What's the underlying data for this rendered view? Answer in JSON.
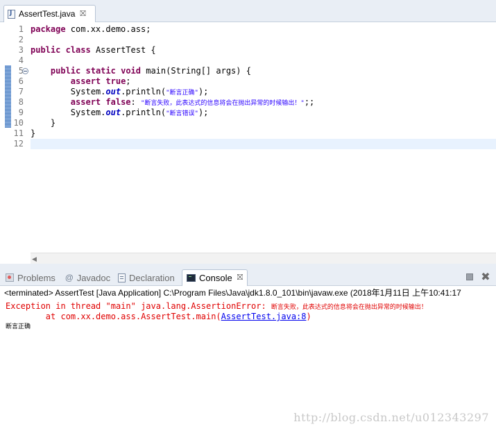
{
  "editor": {
    "tab": {
      "title": "AssertTest.java",
      "close": "⛝"
    },
    "line_numbers": [
      "1",
      "2",
      "3",
      "4",
      "5",
      "6",
      "7",
      "8",
      "9",
      "10",
      "11",
      "12"
    ],
    "code": {
      "l1_kw": "package",
      "l1_rest": " com.xx.demo.ass;",
      "l3_kw1": "public",
      "l3_kw2": "class",
      "l3_rest": " AssertTest {",
      "l5_kw1": "public",
      "l5_kw2": "static",
      "l5_kw3": "void",
      "l5_rest": " main(String[] args) {",
      "l6_kw1": "assert",
      "l6_kw2": "true",
      "l6_rest": ";",
      "l7_a": "System.",
      "l7_field": "out",
      "l7_b": ".println(",
      "l7_str": "\"断言正确\"",
      "l7_c": ");",
      "l8_kw1": "assert",
      "l8_kw2": "false",
      "l8_a": ": ",
      "l8_str": "\"断言失败，此表达式的信息将会在抛出异常的时候输出！\"",
      "l8_b": ";;",
      "l9_a": "System.",
      "l9_field": "out",
      "l9_b": ".println(",
      "l9_str": "\"断言错误\"",
      "l9_c": ");",
      "l10": "    }",
      "l11": "}"
    }
  },
  "views": {
    "tabs": [
      {
        "label": "Problems"
      },
      {
        "label": "Javadoc",
        "icon_glyph": "@"
      },
      {
        "label": "Declaration"
      },
      {
        "label": "Console",
        "close": "⛝"
      }
    ],
    "remove_glyph": "✖"
  },
  "console": {
    "header": "<terminated> AssertTest [Java Application] C:\\Program Files\\Java\\jdk1.8.0_101\\bin\\javaw.exe (2018年1月11日 上午10:41:17",
    "exception_prefix": "Exception in thread \"main\" java.lang.AssertionError: ",
    "exception_msg": "断言失败，此表达式的信息将会在抛出异常的时候输出！",
    "stack_prefix": "        at com.xx.demo.ass.AssertTest.main(",
    "stack_link": "AssertTest.java:8",
    "stack_suffix": ")",
    "output": "断言正确"
  },
  "watermark": "http://blog.csdn.net/u012343297",
  "colors": {
    "keyword": "#7f0055",
    "string": "#2a00ff",
    "field": "#0000c0",
    "error": "#e00000",
    "link": "#0000ee",
    "current_line": "#e8f2fe"
  }
}
